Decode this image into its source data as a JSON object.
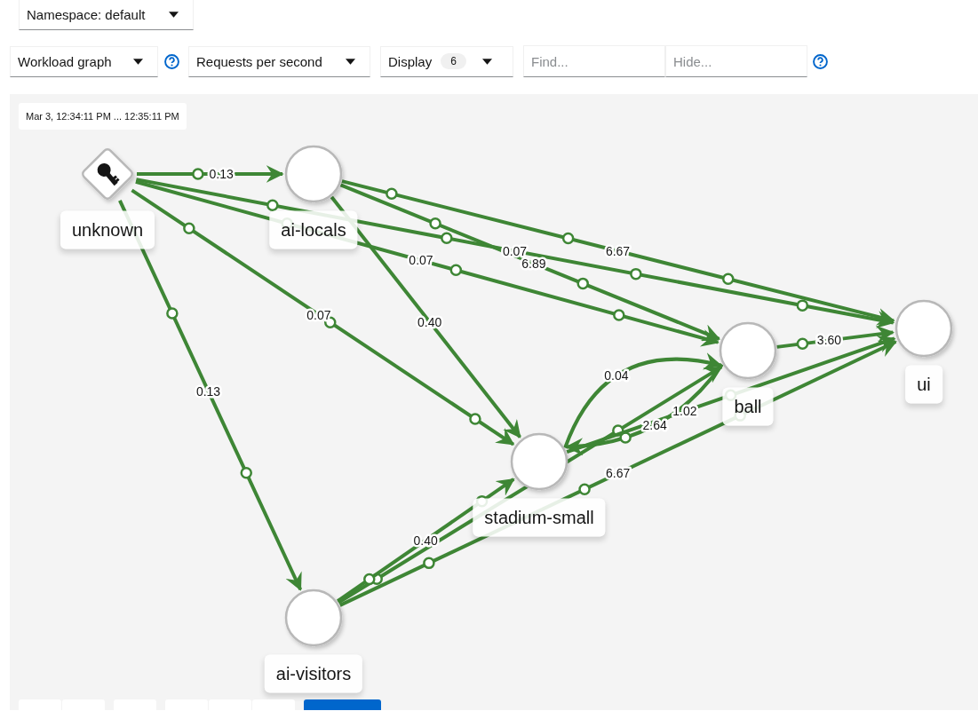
{
  "namespace": {
    "label": "Namespace: default"
  },
  "toolbar": {
    "graph_type": "Workload graph",
    "traffic_metric": "Requests per second",
    "display": {
      "label": "Display",
      "count": "6"
    },
    "find": {
      "placeholder": "Find..."
    },
    "hide": {
      "placeholder": "Hide..."
    }
  },
  "graph": {
    "time_range": "Mar 3, 12:34:11 PM ... 12:35:11 PM",
    "nodes": [
      {
        "label": "unknown",
        "kind": "unknown"
      },
      {
        "label": "ai-locals",
        "kind": "workload"
      },
      {
        "label": "ui",
        "kind": "workload"
      },
      {
        "label": "ball",
        "kind": "workload"
      },
      {
        "label": "stadium-small",
        "kind": "workload"
      },
      {
        "label": "ai-visitors",
        "kind": "workload"
      }
    ],
    "edges": [
      {
        "kind": "labelled",
        "label": "0.13"
      },
      {
        "kind": "labelled",
        "label": "0.07"
      },
      {
        "kind": "labelled",
        "label": "0.07"
      },
      {
        "kind": "labelled",
        "label": "0.07"
      },
      {
        "kind": "labelled",
        "label": "0.13"
      },
      {
        "kind": "labelled",
        "label": "6.67"
      },
      {
        "kind": "labelled",
        "label": "6.89"
      },
      {
        "kind": "labelled",
        "label": "0.40"
      },
      {
        "kind": "labelled",
        "label": "3.60"
      },
      {
        "kind": "labelled",
        "label": "0.04"
      },
      {
        "kind": "unlabelled"
      },
      {
        "kind": "labelled",
        "label": "2.64"
      },
      {
        "kind": "labelled",
        "label": "1.02"
      },
      {
        "kind": "labelled",
        "label": "6.67"
      },
      {
        "kind": "labelled",
        "label": "0.40"
      }
    ]
  },
  "bottom_toolbar": [
    {
      "kind": "plain"
    },
    {
      "kind": "plain"
    },
    {
      "kind": "plain"
    },
    {
      "kind": "plain"
    },
    {
      "kind": "plain"
    },
    {
      "kind": "plain"
    },
    {
      "kind": "primary"
    }
  ]
}
